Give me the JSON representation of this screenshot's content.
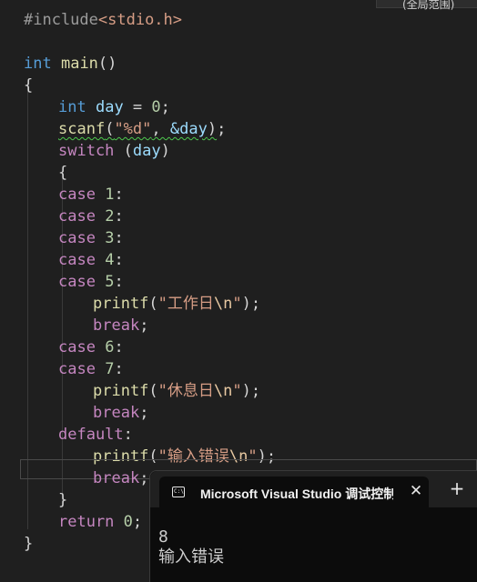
{
  "top_tab": {
    "label": "(全局范围)"
  },
  "code": {
    "include_directive": "#include",
    "include_file": "<stdio.h>",
    "int_kw": "int",
    "main_fn": "main",
    "open_paren_close": "()",
    "brace_open": "{",
    "brace_close": "}",
    "day_var": "day",
    "assign": " = ",
    "zero": "0",
    "semi": ";",
    "scanf_fn": "scanf",
    "fmt_d": "\"%d\"",
    "addr_day": "&day",
    "switch_kw": "switch",
    "case_kw": "case",
    "case_nums": [
      "1",
      "2",
      "3",
      "4",
      "5",
      "6",
      "7"
    ],
    "colon": ":",
    "printf_fn": "printf",
    "str_work_open": "\"工作日",
    "str_rest_open": "\"休息日",
    "str_err_open": "\"输入错误",
    "newline_esc": "\\n",
    "quote": "\"",
    "break_kw": "break",
    "default_kw": "default",
    "return_kw": "return"
  },
  "console": {
    "title": "Microsoft Visual Studio 调试控制台",
    "close_glyph": "✕",
    "new_tab_glyph": "+",
    "lines": [
      "8",
      "输入错误"
    ]
  }
}
